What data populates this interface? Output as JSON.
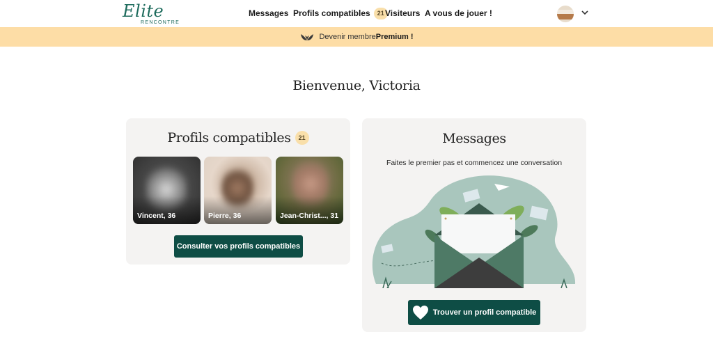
{
  "header": {
    "logo": {
      "word": "Elite",
      "sub": "RENCONTRE"
    },
    "nav": [
      {
        "label": "Messages"
      },
      {
        "label": "Profils compatibles",
        "badge": "21"
      },
      {
        "label": "Visiteurs"
      },
      {
        "label": "A vous de jouer !"
      }
    ],
    "icons": {
      "avatar": "user-avatar",
      "menu": "chevron-down-icon"
    }
  },
  "banner": {
    "prefix": "Devenir membre ",
    "strong": "Premium !",
    "icon": "laurel-icon"
  },
  "welcome": "Bienvenue, Victoria",
  "profils_card": {
    "title": "Profils compatibles",
    "badge": "21",
    "profiles": [
      {
        "name": "Vincent, 36"
      },
      {
        "name": "Pierre, 36"
      },
      {
        "name": "Jean-Christ..., 31"
      }
    ],
    "button": "Consulter vos profils compatibles"
  },
  "messages_card": {
    "title": "Messages",
    "subtitle": "Faites le premier pas et commencez une conversation",
    "illustration": "envelope-illustration",
    "button": "Trouver un profil compatible",
    "button_icon": "heart-icon"
  },
  "colors": {
    "brand": "#0e4d45",
    "banner_bg": "#fddda6",
    "badge_bg": "#f9dfaa",
    "card_bg": "#f4f3f2",
    "illustration_green": "#a9c6bd"
  }
}
